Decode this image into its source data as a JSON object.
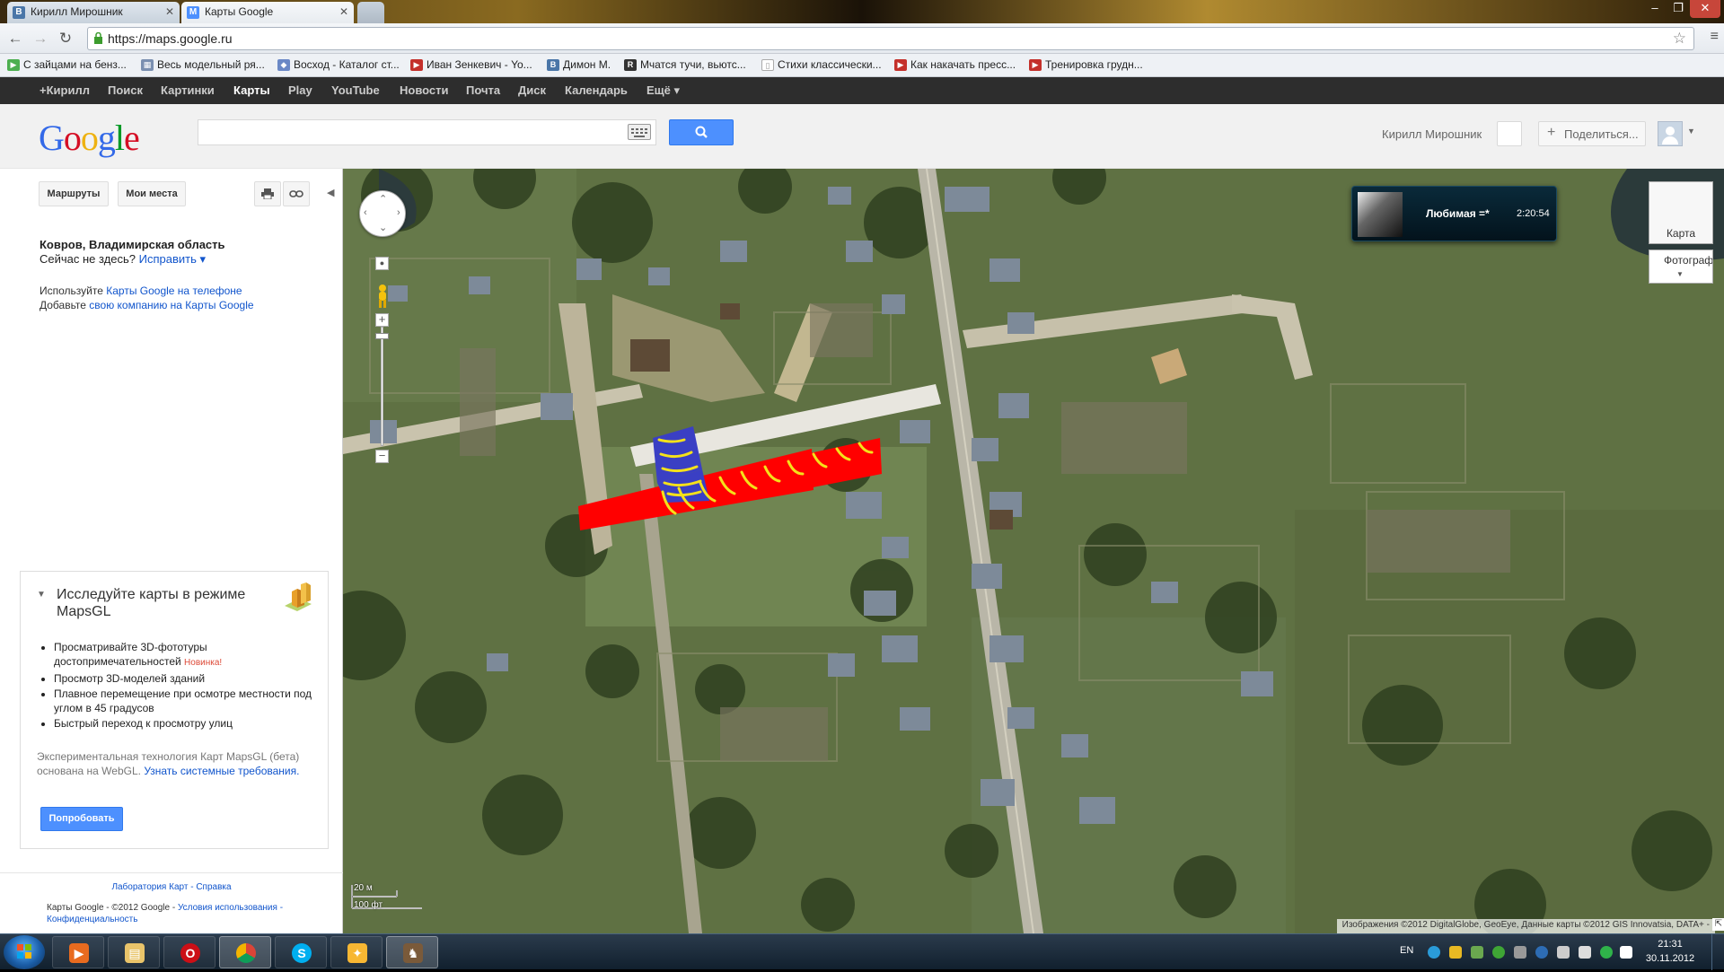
{
  "browser": {
    "tabs": [
      {
        "label": "Кирилл Мирошник",
        "icon": "vk-icon"
      },
      {
        "label": "Карты Google",
        "icon": "google-maps-icon"
      }
    ],
    "url": "https://maps.google.ru",
    "bookmarks": [
      {
        "label": "С зайцами на бенз...",
        "icon": "play-arrow-icon"
      },
      {
        "label": "Весь модельный ря...",
        "icon": "thumbnail-icon"
      },
      {
        "label": "Восход - Каталог ст...",
        "icon": "diamond-icon"
      },
      {
        "label": "Иван Зенкевич - Yo...",
        "icon": "youtube-icon"
      },
      {
        "label": "Димон М.",
        "icon": "vk-icon"
      },
      {
        "label": "Мчатся тучи, вьютс...",
        "icon": "rk-icon"
      },
      {
        "label": "Стихи классически...",
        "icon": "page-icon"
      },
      {
        "label": "Как накачать пресс...",
        "icon": "youtube-icon"
      },
      {
        "label": "Тренировка грудн...",
        "icon": "youtube-icon"
      }
    ]
  },
  "gbar": {
    "items": [
      "+Кирилл",
      "Поиск",
      "Картинки",
      "Карты",
      "Play",
      "YouTube",
      "Новости",
      "Почта",
      "Диск",
      "Календарь",
      "Ещё ▾"
    ],
    "active": "Карты"
  },
  "header": {
    "logo": "Google",
    "search_value": "",
    "user_name": "Кирилл Мирошник",
    "share_label": "Поделиться..."
  },
  "left_panel": {
    "routes_label": "Маршруты",
    "my_places_label": "Мои места",
    "location_title": "Ковров, Владимирская область",
    "not_here": "Сейчас не здесь?",
    "fix_link": "Исправить ▾",
    "promo_use_prefix": "Используйте",
    "promo_use_link": "Карты Google на телефоне",
    "promo_add_prefix": "Добавьте",
    "promo_add_link": "свою компанию на Карты Google",
    "mapsgl": {
      "title": "Исследуйте карты в режиме MapsGL",
      "bullets": [
        "Просматривайте 3D-фототуры достопримечательностей",
        "Просмотр 3D-моделей зданий",
        "Плавное перемещение при осмотре местности под углом в 45 градусов",
        "Быстрый переход к просмотру улиц"
      ],
      "new_badge": "Новинка!",
      "desc": "Экспериментальная технология Карт MapsGL (бета) основана на WebGL.",
      "desc_link": "Узнать системные требования.",
      "try_label": "Попробовать"
    },
    "footer_links": "Лаборатория Карт - Справка",
    "footer_copyright": "Карты Google - ©2012 Google -",
    "footer_terms": "Условия использования - Конфиденциальность"
  },
  "map": {
    "music_title": "Любимая =*",
    "music_time": "2:20:54",
    "maptype_map": "Карта",
    "maptype_photo": "Фотограф",
    "scale_m": "20 м",
    "scale_ft": "100 фт",
    "attribution": "Изображения ©2012 DigitalGlobe, GeoEye, Данные карты ©2012 GIS Innovatsia, DATA+ -"
  },
  "taskbar": {
    "lang": "EN",
    "time": "21:31",
    "date": "30.11.2012"
  }
}
